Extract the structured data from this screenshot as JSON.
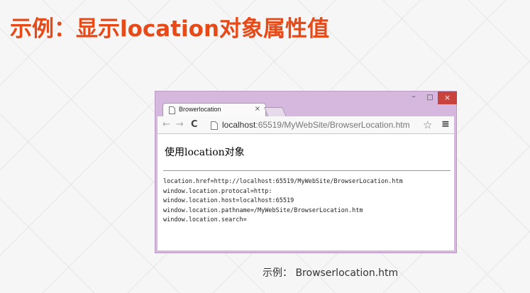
{
  "slide": {
    "title": "示例：显示location对象属性值",
    "caption": "示例： Browserlocation.htm"
  },
  "colors": {
    "title": "#e64a19",
    "window_frame": "#d6b8de",
    "close_button": "#c7433c"
  },
  "browser": {
    "window_controls": {
      "minimize": "–",
      "maximize": "□",
      "close": "×"
    },
    "tab": {
      "title": "Browerlocation",
      "close": "×"
    },
    "toolbar": {
      "back": "←",
      "forward": "→",
      "reload": "C",
      "url_host": "localhost",
      "url_rest": ":65519/MyWebSite/BrowserLocation.htm",
      "star": "☆",
      "menu": "≡"
    },
    "page": {
      "heading": "使用location对象",
      "lines": [
        "location.href=http://localhost:65519/MyWebSite/BrowserLocation.htm",
        "window.location.protocal=http:",
        "window.location.host=localhost:65519",
        "window.location.pathname=/MyWebSite/BrowserLocation.htm",
        "window.location.search="
      ]
    }
  }
}
